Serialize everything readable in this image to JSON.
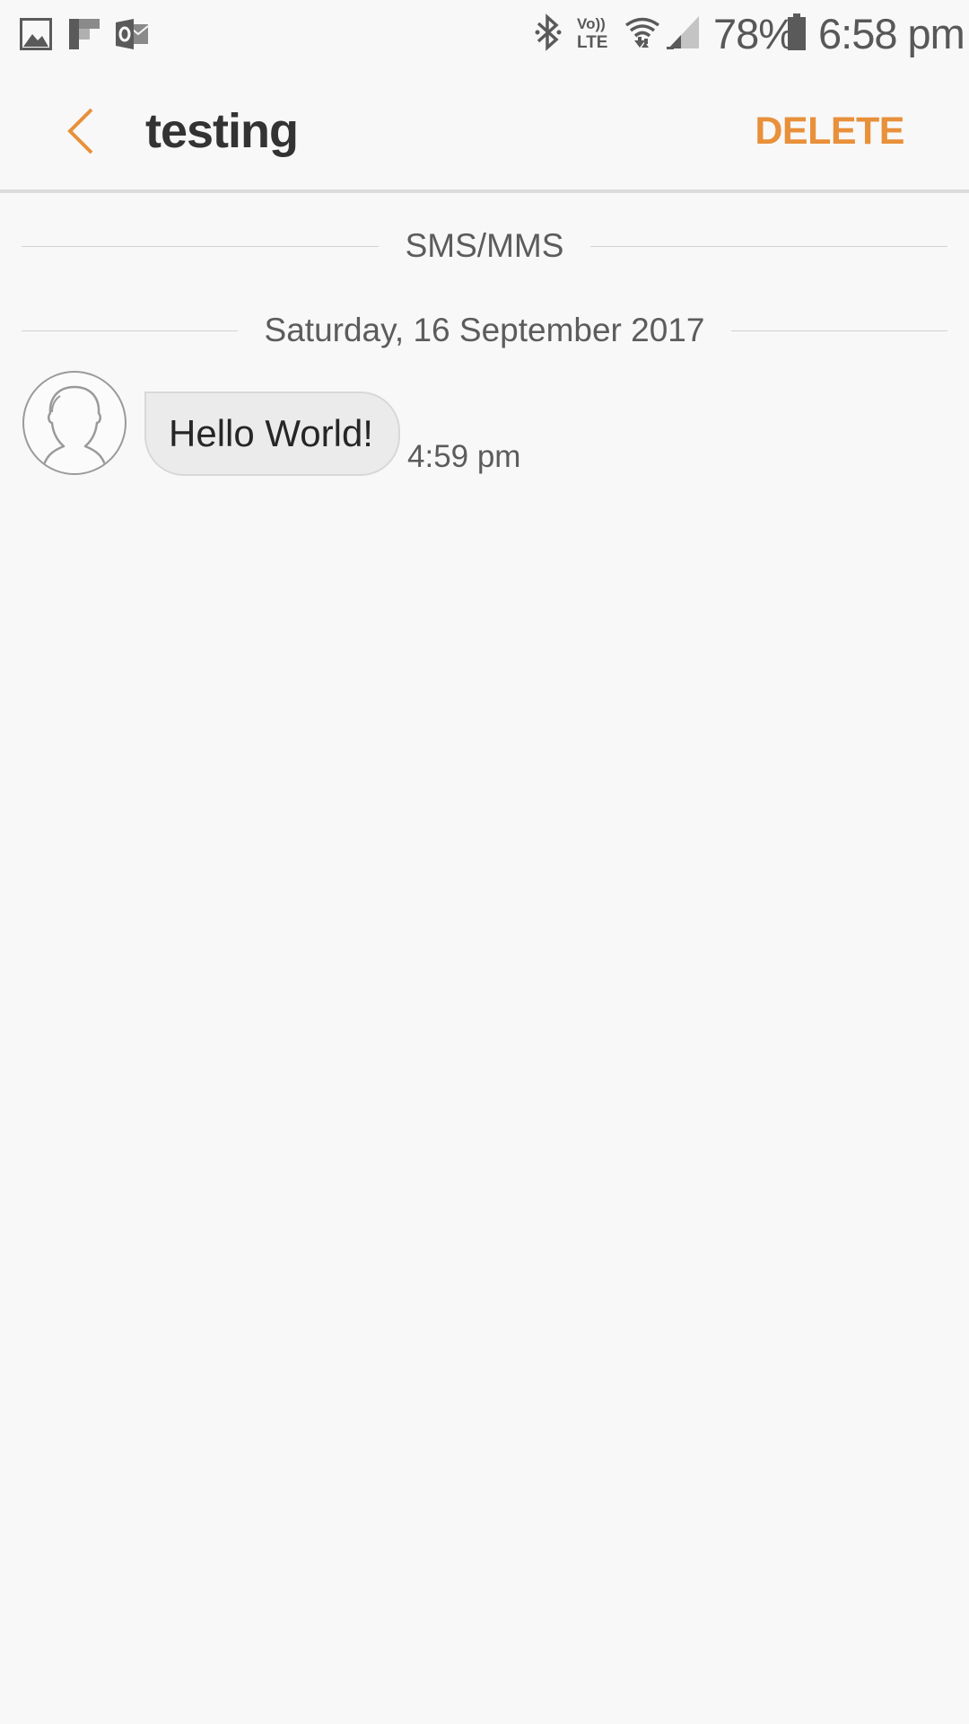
{
  "status_bar": {
    "battery_percent": "78%",
    "battery_level": 0.78,
    "time": "6:58 pm",
    "icons": [
      "gallery-icon",
      "flipboard-icon",
      "outlook-icon",
      "bluetooth-icon",
      "volte-icon",
      "wifi-icon",
      "signal-icon",
      "battery-icon"
    ]
  },
  "header": {
    "title": "testing",
    "delete_label": "DELETE",
    "back_icon": "back-chevron-icon"
  },
  "conversation": {
    "channel_label": "SMS/MMS",
    "date_label": "Saturday, 16 September 2017",
    "messages": [
      {
        "text": "Hello World!",
        "time": "4:59 pm",
        "direction": "incoming"
      }
    ]
  },
  "colors": {
    "accent": "#e8903a",
    "background": "#f8f8f8",
    "bubble": "#ebebeb"
  }
}
